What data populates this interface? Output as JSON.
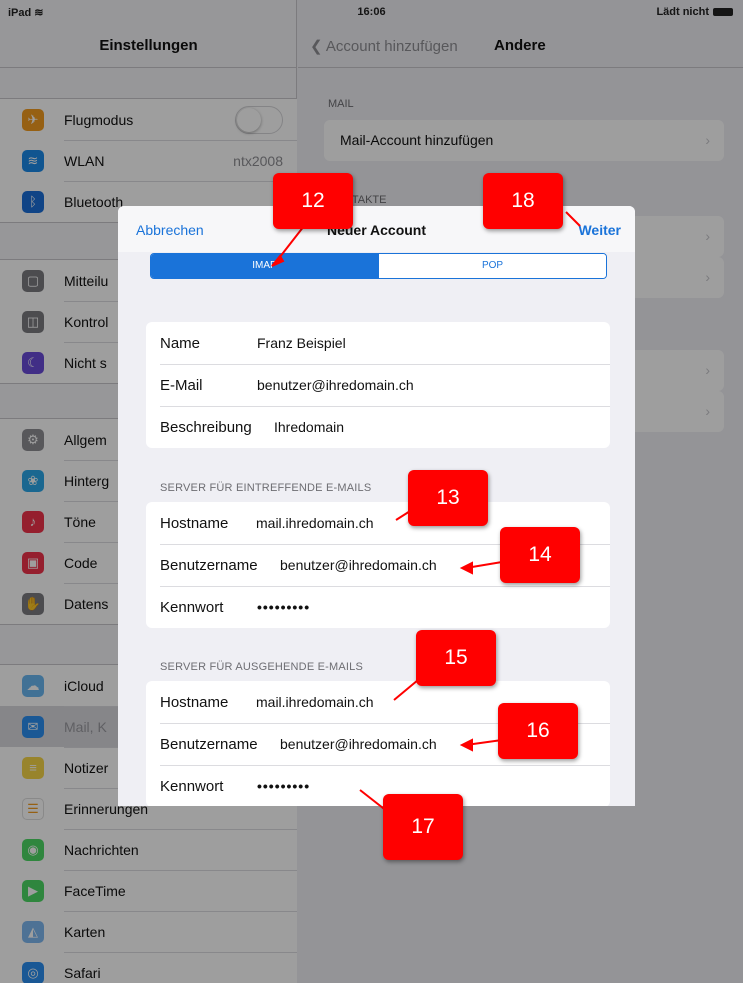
{
  "status": {
    "device": "iPad",
    "time": "16:06",
    "battery": "Lädt nicht"
  },
  "sidebar": {
    "title": "Einstellungen",
    "group1": [
      {
        "label": "Flugmodus",
        "icon": "airplane-icon",
        "color": "#f39c1f",
        "glyph": "✈",
        "toggle": true
      },
      {
        "label": "WLAN",
        "icon": "wifi-icon",
        "color": "#1a8ae8",
        "glyph": "≋",
        "value": "ntx2008"
      },
      {
        "label": "Bluetooth",
        "icon": "bluetooth-icon",
        "color": "#1a6fd8",
        "glyph": "ᛒ",
        "value": "E"
      }
    ],
    "group2": [
      {
        "label": "Mitteilu",
        "icon": "notifications-icon",
        "color": "#7b7b80",
        "glyph": "▢"
      },
      {
        "label": "Kontrol",
        "icon": "control-center-icon",
        "color": "#7b7b80",
        "glyph": "◫"
      },
      {
        "label": "Nicht s",
        "icon": "moon-icon",
        "color": "#6a4bd8",
        "glyph": "☾"
      }
    ],
    "group3": [
      {
        "label": "Allgem",
        "icon": "gear-icon",
        "color": "#8e8e93",
        "glyph": "⚙"
      },
      {
        "label": "Hinterg",
        "icon": "wallpaper-icon",
        "color": "#2aa7e8",
        "glyph": "❀"
      },
      {
        "label": "Töne",
        "icon": "sound-icon",
        "color": "#f0324b",
        "glyph": "♪"
      },
      {
        "label": "Code",
        "icon": "lock-icon",
        "color": "#f0324b",
        "glyph": "▣"
      },
      {
        "label": "Datens",
        "icon": "privacy-hand-icon",
        "color": "#7b7b80",
        "glyph": "✋"
      }
    ],
    "group4": [
      {
        "label": "iCloud",
        "icon": "cloud-icon",
        "color": "#6ab7f0",
        "glyph": "☁"
      },
      {
        "label": "Mail, K",
        "icon": "mail-icon",
        "color": "#2a8ef0",
        "glyph": "✉",
        "selected": true
      },
      {
        "label": "Notizer",
        "icon": "notes-icon",
        "color": "#f5d547",
        "glyph": "≡"
      },
      {
        "label": "Erinnerungen",
        "icon": "reminders-icon",
        "color": "#ffffff",
        "glyph": "☰"
      },
      {
        "label": "Nachrichten",
        "icon": "messages-icon",
        "color": "#4cd964",
        "glyph": "◉"
      },
      {
        "label": "FaceTime",
        "icon": "facetime-icon",
        "color": "#4cd964",
        "glyph": "▶"
      },
      {
        "label": "Karten",
        "icon": "maps-icon",
        "color": "#7fb8f0",
        "glyph": "◭"
      },
      {
        "label": "Safari",
        "icon": "safari-icon",
        "color": "#2a8ef0",
        "glyph": "◎"
      }
    ]
  },
  "detail": {
    "back": "Account hinzufügen",
    "title": "Andere",
    "section_mail": "MAIL",
    "mail_add": "Mail-Account hinzufügen",
    "section_contacts": "KONTAKTE"
  },
  "modal": {
    "cancel": "Abbrechen",
    "title": "Neuer Account",
    "next": "Weiter",
    "segments": [
      "IMAP",
      "POP"
    ],
    "account": {
      "name_label": "Name",
      "name_value": "Franz Beispiel",
      "email_label": "E-Mail",
      "email_value": "benutzer@ihredomain.ch",
      "desc_label": "Beschreibung",
      "desc_value": "Ihredomain"
    },
    "incoming": {
      "section": "SERVER FÜR EINTREFFENDE E-MAILS",
      "host_label": "Hostname",
      "host_value": "mail.ihredomain.ch",
      "user_label": "Benutzername",
      "user_value": "benutzer@ihredomain.ch",
      "pass_label": "Kennwort",
      "pass_value": "•••••••••"
    },
    "outgoing": {
      "section": "SERVER FÜR AUSGEHENDE E-MAILS",
      "host_label": "Hostname",
      "host_value": "mail.ihredomain.ch",
      "user_label": "Benutzername",
      "user_value": "benutzer@ihredomain.ch",
      "pass_label": "Kennwort",
      "pass_value": "•••••••••"
    }
  },
  "callouts": [
    "12",
    "13",
    "14",
    "15",
    "16",
    "17",
    "18"
  ]
}
